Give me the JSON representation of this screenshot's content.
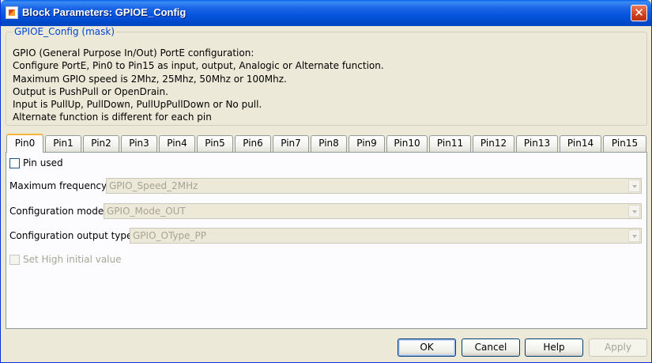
{
  "window": {
    "title": "Block Parameters: GPIOE_Config",
    "close_glyph": "✕"
  },
  "mask": {
    "legend": "GPIOE_Config (mask)",
    "description": [
      "GPIO (General Purpose In/Out) PortE configuration:",
      "Configure PortE, Pin0 to Pin15 as input, output, Analogic or Alternate function.",
      "Maximum GPIO speed is 2Mhz, 25Mhz, 50Mhz or 100Mhz.",
      "Output is PushPull or OpenDrain.",
      "Input is PullUp, PullDown, PullUpPullDown or No pull.",
      "Alternate function is different for each pin"
    ]
  },
  "tabs": [
    "Pin0",
    "Pin1",
    "Pin2",
    "Pin3",
    "Pin4",
    "Pin5",
    "Pin6",
    "Pin7",
    "Pin8",
    "Pin9",
    "Pin10",
    "Pin11",
    "Pin12",
    "Pin13",
    "Pin14",
    "Pin15"
  ],
  "active_tab": "Pin0",
  "pin": {
    "pin_used_label": "Pin used",
    "pin_used_checked": false,
    "max_freq_label": "Maximum frequency",
    "max_freq_value": "GPIO_Speed_2MHz",
    "config_mode_label": "Configuration mode",
    "config_mode_value": "GPIO_Mode_OUT",
    "output_type_label": "Configuration output type",
    "output_type_value": "GPIO_OType_PP",
    "set_high_label": "Set High initial value",
    "set_high_checked": false
  },
  "buttons": {
    "ok": "OK",
    "cancel": "Cancel",
    "help": "Help",
    "apply": "Apply"
  },
  "colors": {
    "title_bar": "#0554de",
    "legend_text": "#0046d5",
    "active_tab_accent": "#f7b338",
    "disabled_text": "#a5a496"
  }
}
